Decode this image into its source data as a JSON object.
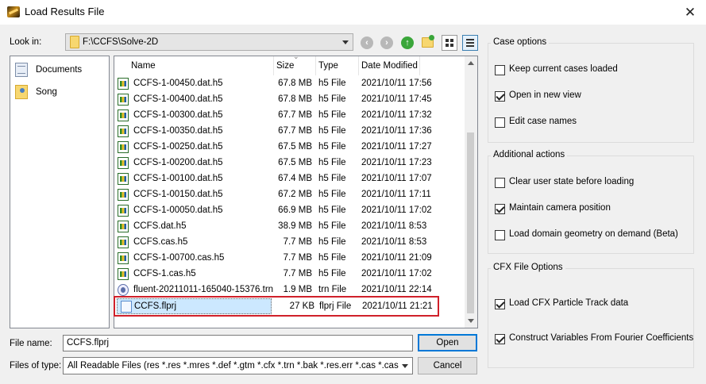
{
  "window": {
    "title": "Load Results File",
    "close_glyph": "✕"
  },
  "look_in": {
    "label": "Look in:",
    "value": "F:\\CCFS\\Solve-2D"
  },
  "toolbar": {
    "icons": [
      "back-icon",
      "forward-icon",
      "up-folder-icon",
      "new-folder-icon",
      "list-view-icon",
      "detail-view-icon"
    ]
  },
  "places": [
    {
      "label": "Documents",
      "icon": "documents-icon"
    },
    {
      "label": "Song",
      "icon": "user-folder-icon"
    }
  ],
  "columns": {
    "name": "Name",
    "size": "Size",
    "type": "Type",
    "date": "Date Modified"
  },
  "files": [
    {
      "name": "CCFS-1-00450.dat.h5",
      "size": "67.8 MB",
      "type": "h5 File",
      "date": "2021/10/11 17:56",
      "icon": "h5"
    },
    {
      "name": "CCFS-1-00400.dat.h5",
      "size": "67.8 MB",
      "type": "h5 File",
      "date": "2021/10/11 17:45",
      "icon": "h5"
    },
    {
      "name": "CCFS-1-00300.dat.h5",
      "size": "67.7 MB",
      "type": "h5 File",
      "date": "2021/10/11 17:32",
      "icon": "h5"
    },
    {
      "name": "CCFS-1-00350.dat.h5",
      "size": "67.7 MB",
      "type": "h5 File",
      "date": "2021/10/11 17:36",
      "icon": "h5"
    },
    {
      "name": "CCFS-1-00250.dat.h5",
      "size": "67.5 MB",
      "type": "h5 File",
      "date": "2021/10/11 17:27",
      "icon": "h5"
    },
    {
      "name": "CCFS-1-00200.dat.h5",
      "size": "67.5 MB",
      "type": "h5 File",
      "date": "2021/10/11 17:23",
      "icon": "h5"
    },
    {
      "name": "CCFS-1-00100.dat.h5",
      "size": "67.4 MB",
      "type": "h5 File",
      "date": "2021/10/11 17:07",
      "icon": "h5"
    },
    {
      "name": "CCFS-1-00150.dat.h5",
      "size": "67.2 MB",
      "type": "h5 File",
      "date": "2021/10/11 17:11",
      "icon": "h5"
    },
    {
      "name": "CCFS-1-00050.dat.h5",
      "size": "66.9 MB",
      "type": "h5 File",
      "date": "2021/10/11 17:02",
      "icon": "h5"
    },
    {
      "name": "CCFS.dat.h5",
      "size": "38.9 MB",
      "type": "h5 File",
      "date": "2021/10/11 8:53",
      "icon": "h5"
    },
    {
      "name": "CCFS.cas.h5",
      "size": "7.7 MB",
      "type": "h5 File",
      "date": "2021/10/11 8:53",
      "icon": "h5"
    },
    {
      "name": "CCFS-1-00700.cas.h5",
      "size": "7.7 MB",
      "type": "h5 File",
      "date": "2021/10/11 21:09",
      "icon": "h5"
    },
    {
      "name": "CCFS-1.cas.h5",
      "size": "7.7 MB",
      "type": "h5 File",
      "date": "2021/10/11 17:02",
      "icon": "h5"
    },
    {
      "name": "fluent-20211011-165040-15376.trn",
      "size": "1.9 MB",
      "type": "trn File",
      "date": "2021/10/11 22:14",
      "icon": "trn"
    },
    {
      "name": "CCFS.flprj",
      "size": "27 KB",
      "type": "flprj File",
      "date": "2021/10/11 21:21",
      "icon": "flprj",
      "selected": true
    }
  ],
  "file_name": {
    "label": "File name:",
    "value": "CCFS.flprj"
  },
  "file_type": {
    "label": "Files of type:",
    "value": "All Readable Files (res *.res *.mres *.def *.gtm *.cfx *.trn *.bak *.res.err *.cas *.cas"
  },
  "buttons": {
    "open": "Open",
    "cancel": "Cancel"
  },
  "case_options": {
    "title": "Case options",
    "items": [
      {
        "label": "Keep current cases loaded",
        "checked": false
      },
      {
        "label": "Open in new view",
        "checked": true
      },
      {
        "label": "Edit case names",
        "checked": false
      }
    ]
  },
  "additional_actions": {
    "title": "Additional actions",
    "items": [
      {
        "label": "Clear user state before loading",
        "checked": false
      },
      {
        "label": "Maintain camera position",
        "checked": true
      },
      {
        "label": "Load domain geometry on demand (Beta)",
        "checked": false
      }
    ]
  },
  "cfx_options": {
    "title": "CFX File Options",
    "items": [
      {
        "label": "Load CFX Particle Track data",
        "checked": true
      },
      {
        "label": "Construct Variables From Fourier Coefficients",
        "checked": true
      }
    ]
  }
}
